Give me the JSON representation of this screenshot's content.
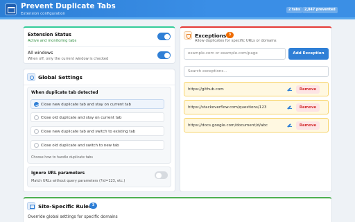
{
  "header": {
    "title": "Prevent Duplicate Tabs",
    "subtitle": "Extension configuration",
    "tabs_pill": "2 tabs",
    "prevented_pill": "2,847 prevented"
  },
  "status": {
    "title": "Extension Status",
    "subtitle": "Active and monitoring tabs",
    "enabled": true,
    "all_windows_title": "All windows",
    "all_windows_sub": "When off, only the current window is checked",
    "all_windows_enabled": true
  },
  "global": {
    "title": "Global Settings",
    "duplicate_label": "When duplicate tab detected",
    "options": [
      {
        "label": "Close new duplicate tab and stay on current tab",
        "selected": true
      },
      {
        "label": "Close old duplicate and stay on current tab",
        "selected": false
      },
      {
        "label": "Close new duplicate tab and switch to existing tab",
        "selected": false
      },
      {
        "label": "Close old duplicate and switch to new tab",
        "selected": false
      }
    ],
    "choose_hint": "Choose how to handle duplicate tabs",
    "ignore_title": "Ignore URL parameters",
    "ignore_sub": "Match URLs without query parameters (?id=123, etc.)",
    "ignore_enabled": false
  },
  "exceptions": {
    "title": "Exceptions",
    "count": "3",
    "subtitle": "Allow duplicates for specific URLs or domains",
    "url_placeholder": "example.com or example.com/page",
    "add_label": "Add Exception",
    "search_placeholder": "Search exceptions...",
    "remove_label": "Remove",
    "items": [
      "https://github.com",
      "https://stackoverflow.com/questions/123",
      "https://docs.google.com/document/d/abc"
    ]
  },
  "site": {
    "title": "Site-Specific Rules",
    "count": "3",
    "subtitle": "Override global settings for specific domains"
  },
  "colors": {
    "accent": "#2f7fd6",
    "exception_row": "#fff8e1",
    "remove": "#d32f2f",
    "success": "#2a8a3a"
  },
  "icons": [
    "app-logo-icon",
    "gear-icon",
    "shield-icon",
    "site-icon",
    "edit-icon",
    "check-icon"
  ]
}
